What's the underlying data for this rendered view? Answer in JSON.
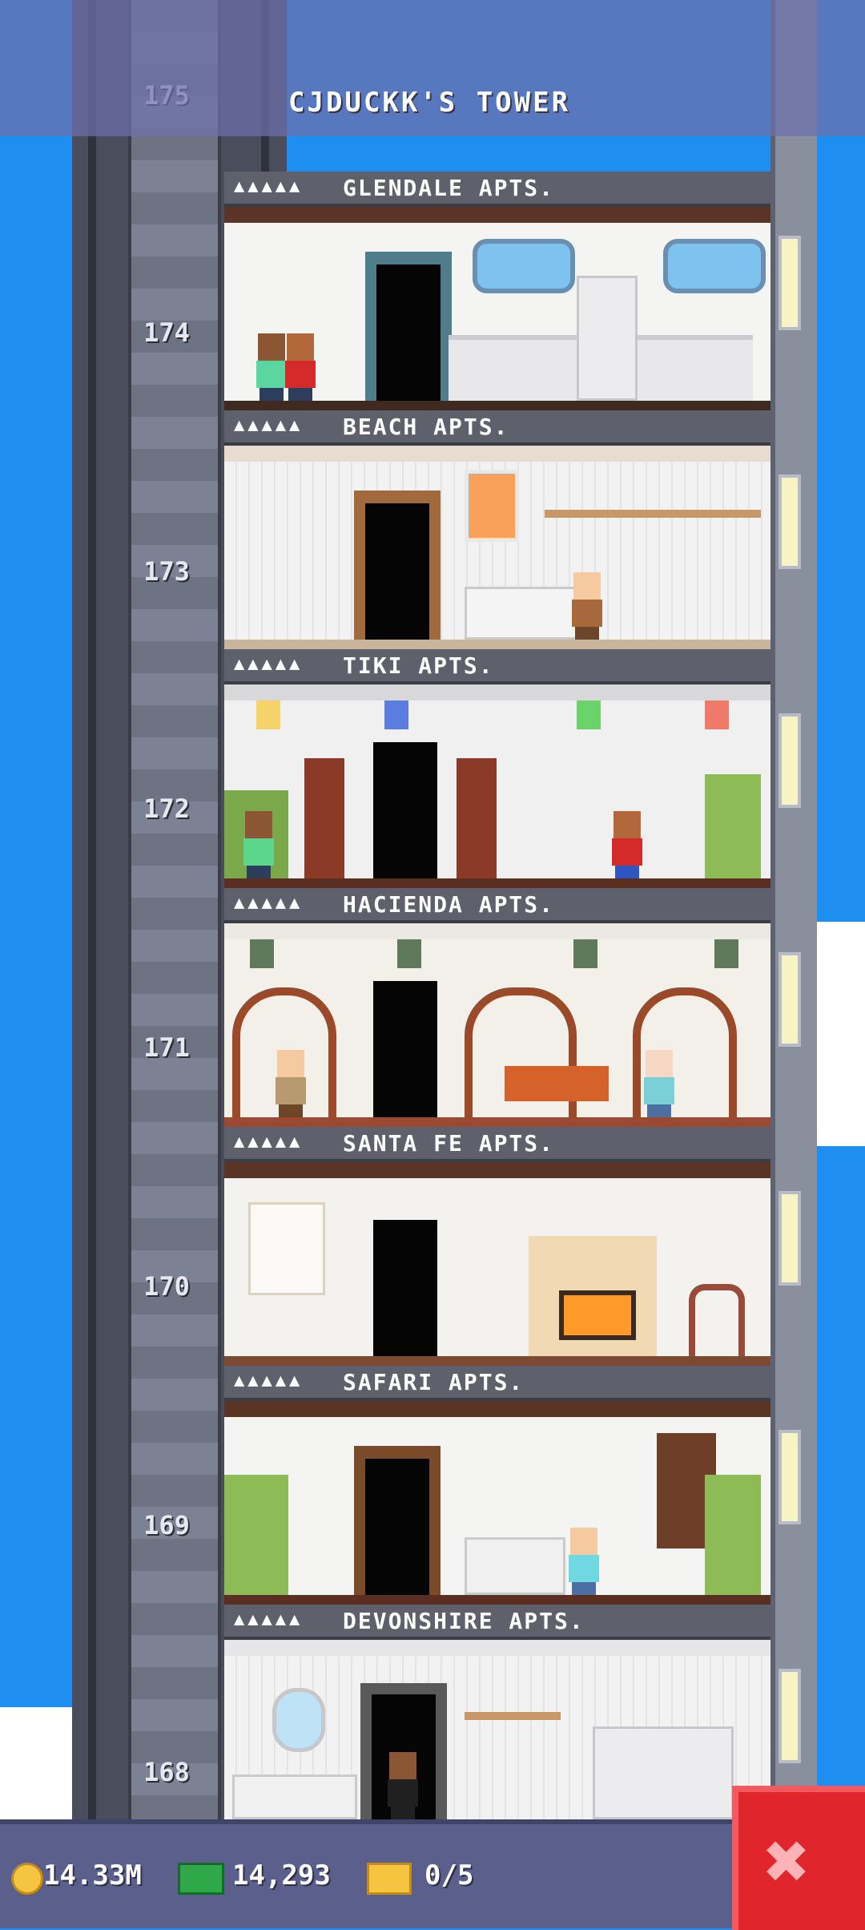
{
  "header": {
    "title": "CJDUCKK'S TOWER",
    "top_floor_number": "175"
  },
  "floors": [
    {
      "number": "174",
      "stars": "▲▲▲▲▲",
      "name": "GLENDALE APTS."
    },
    {
      "number": "173",
      "stars": "▲▲▲▲▲",
      "name": "BEACH APTS."
    },
    {
      "number": "172",
      "stars": "▲▲▲▲▲",
      "name": "TIKI APTS."
    },
    {
      "number": "171",
      "stars": "▲▲▲▲▲",
      "name": "HACIENDA APTS."
    },
    {
      "number": "170",
      "stars": "▲▲▲▲▲",
      "name": "SANTA FE APTS."
    },
    {
      "number": "169",
      "stars": "▲▲▲▲▲",
      "name": "SAFARI APTS."
    },
    {
      "number": "168",
      "stars": "▲▲▲▲▲",
      "name": "DEVONSHIRE APTS."
    }
  ],
  "hud": {
    "coins": "14.33M",
    "bux": "14,293",
    "tickets": "0/5",
    "icons": {
      "coins": "gold-coin-icon",
      "bux": "tower-bux-icon",
      "tickets": "golden-ticket-icon"
    }
  },
  "close": {
    "icon": "close-icon",
    "symbol": "✖"
  },
  "colors": {
    "sky": "#1e8ef0",
    "header": "#6e70aa",
    "hud_bar": "#5a5f8c",
    "close": "#e0252c"
  }
}
